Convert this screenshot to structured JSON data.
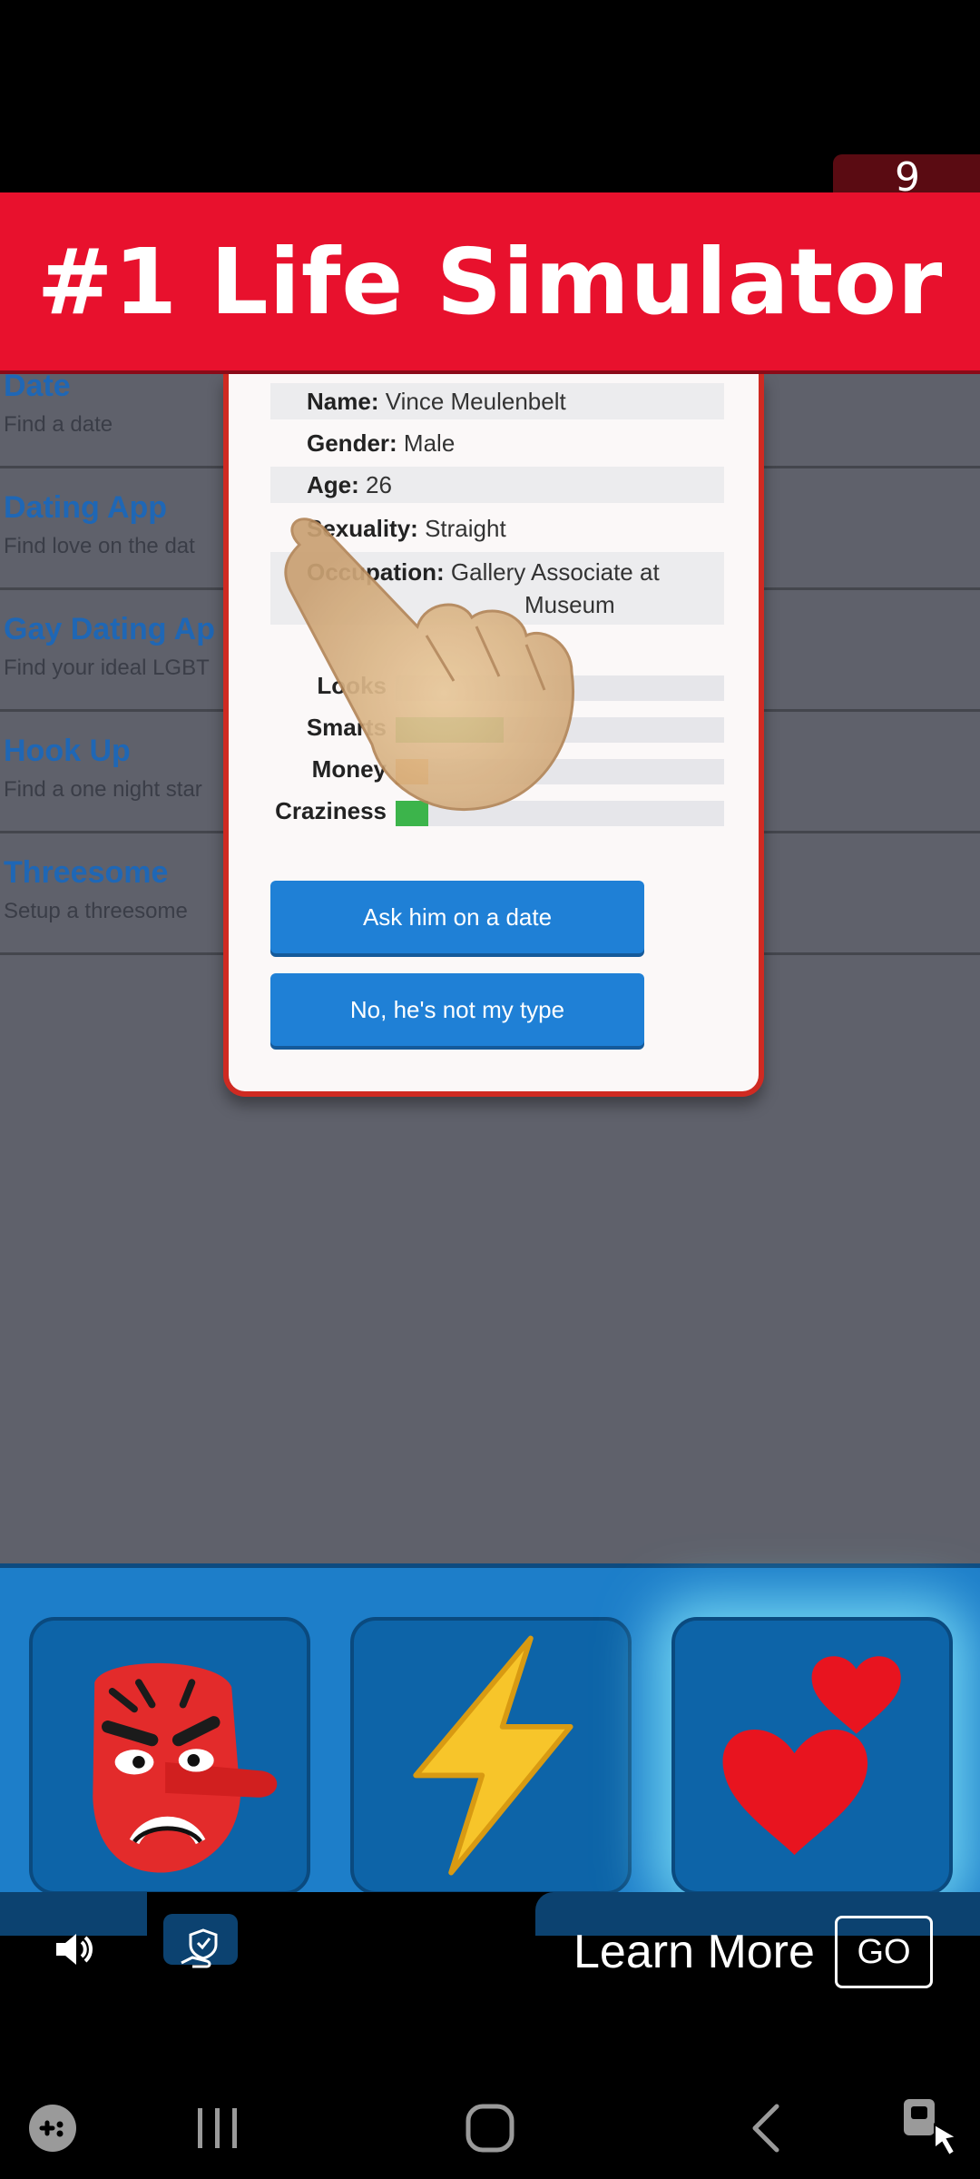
{
  "countdown": "9",
  "banner": {
    "title": "#1 Life Simulator"
  },
  "menu": {
    "items": [
      {
        "title": "Date",
        "subtitle": "Find a date"
      },
      {
        "title": "Dating App",
        "subtitle": "Find love on the dat"
      },
      {
        "title": "Gay Dating Ap",
        "subtitle": "Find your ideal LGBT"
      },
      {
        "title": "Hook Up",
        "subtitle": "Find a one night star"
      },
      {
        "title": "Threesome",
        "subtitle": "Setup a threesome"
      }
    ]
  },
  "profile": {
    "name_label": "Name:",
    "name": "Vince Meulenbelt",
    "gender_label": "Gender:",
    "gender": "Male",
    "age_label": "Age:",
    "age": "26",
    "sexuality_label": "Sexuality:",
    "sexuality": "Straight",
    "occupation_label": "Occupation:",
    "occupation_line1": "Gallery Associate at",
    "occupation_line2": "Museum",
    "stats": [
      {
        "label": "Looks",
        "value": 0.0,
        "color": "#3cb44b"
      },
      {
        "label": "Smarts",
        "value": 0.33,
        "color": "#3cb44b"
      },
      {
        "label": "Money",
        "value": 0.1,
        "color": "#f08c1e"
      },
      {
        "label": "Craziness",
        "value": 0.1,
        "color": "#3cb44b"
      }
    ],
    "ask_button": "Ask him on a date",
    "decline_button": "No, he's not my type"
  },
  "emoji_tiles": [
    {
      "icon": "tengu-goblin-icon"
    },
    {
      "icon": "lightning-bolt-icon"
    },
    {
      "icon": "two-hearts-icon"
    }
  ],
  "ad": {
    "learn_more": "Learn More",
    "go": "GO"
  },
  "colors": {
    "banner": "#e8112d",
    "panel": "#1d7ec9",
    "button": "#1f80d6"
  }
}
